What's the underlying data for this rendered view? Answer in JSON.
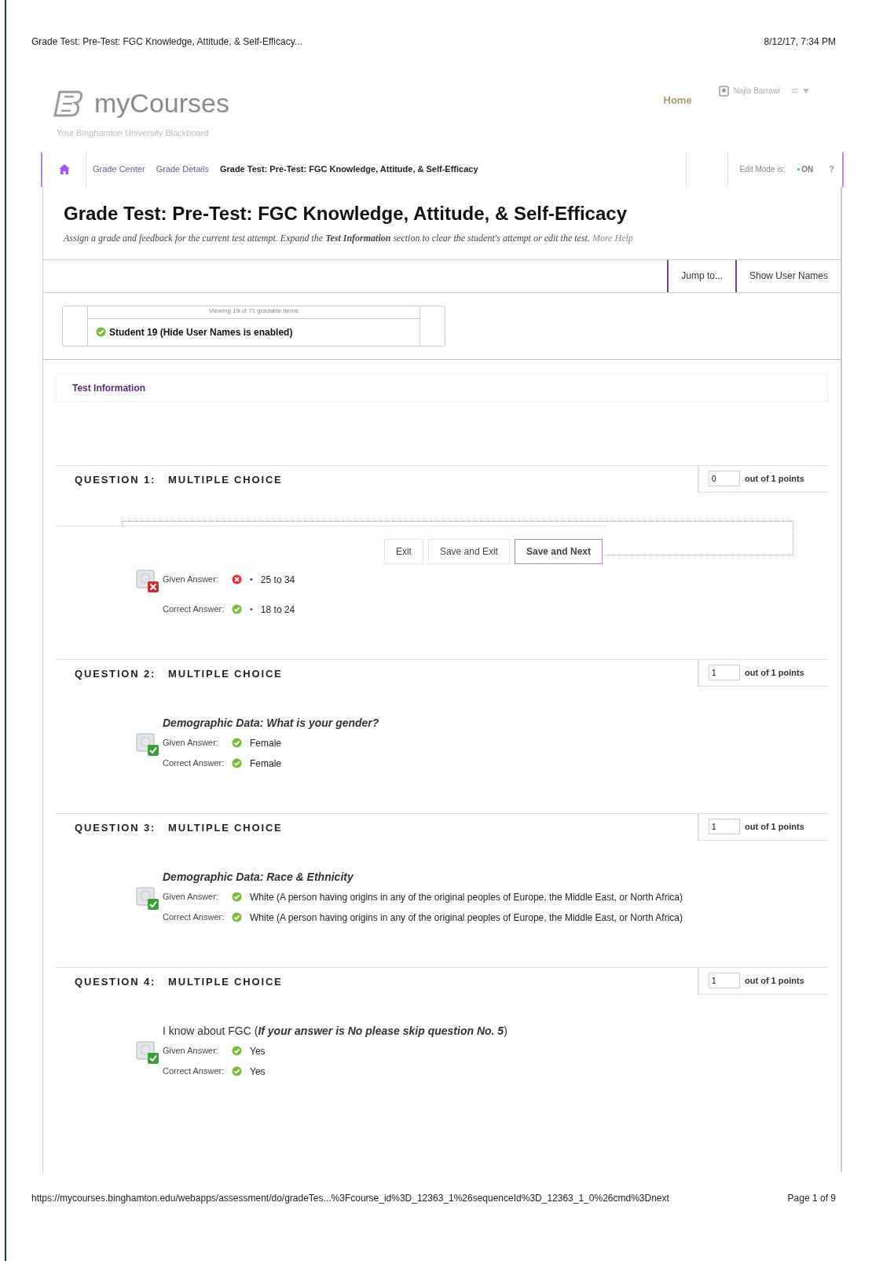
{
  "print_header": {
    "title": "Grade Test: Pre-Test: FGC Knowledge, Attitude, & Self-Efficacy...",
    "date": "8/12/17, 7:34 PM"
  },
  "brand": {
    "name": "myCourses",
    "tagline": "Your Binghamton University Blackboard"
  },
  "top_nav": {
    "home": "Home",
    "user": "Najla Barrawi",
    "count": "32"
  },
  "breadcrumbs": [
    {
      "label": "Grade Center",
      "current": false
    },
    {
      "label": "Grade Details",
      "current": false
    },
    {
      "label": "Grade Test: Pre-Test: FGC Knowledge, Attitude, & Self-Efficacy",
      "current": true
    }
  ],
  "edit_mode": {
    "label": "Edit Mode is:",
    "value": "ON",
    "on": true,
    "help": "?"
  },
  "page": {
    "title": "Grade Test: Pre-Test: FGC Knowledge, Attitude, & Self-Efficacy",
    "description": "Assign a grade and feedback for the current test attempt. Expand the **Test Information** section to clear the student's attempt or edit the test.",
    "help_link": "More Help"
  },
  "toolbar": [
    "Jump to...",
    "Show User Names"
  ],
  "student": {
    "viewing": "Viewing 19 of 71 gradable items",
    "name": "Student 19 (Hide User Names is enabled)"
  },
  "test_information": "Test Information",
  "questions": [
    {
      "number": "QUESTION 1:",
      "type": "MULTIPLE CHOICE",
      "score": "0",
      "out_of": "out of 1 points",
      "correct": false,
      "given_label": "Given Answer:",
      "given": "25 to 34",
      "correct_label": "Correct Answer:",
      "answer": "18 to 24",
      "marker": "•",
      "actions": [
        "Exit",
        "Save and Exit",
        "Save and Next"
      ]
    },
    {
      "number": "QUESTION 2:",
      "type": "MULTIPLE CHOICE",
      "score": "1",
      "out_of": "out of 1 points",
      "prompt": "**Demographic Data: What is your gender?**",
      "correct": true,
      "given_label": "Given Answer:",
      "given": "Female",
      "correct_label": "Correct Answer:",
      "answer": "Female"
    },
    {
      "number": "QUESTION 3:",
      "type": "MULTIPLE CHOICE",
      "score": "1",
      "out_of": "out of 1 points",
      "prompt": "**Demographic Data: Race & Ethnicity**",
      "correct": true,
      "given_label": "Given Answer:",
      "given": "White (A person having origins in any of the original peoples of Europe, the Middle East, or North Africa)",
      "correct_label": "Correct Answer:",
      "answer": "White (A person having origins in any of the original peoples of Europe, the Middle East, or North Africa)"
    },
    {
      "number": "QUESTION 4:",
      "type": "MULTIPLE CHOICE",
      "score": "1",
      "out_of": "out of 1 points",
      "prompt": "I know about FGC (**If your answer is No please skip question No. 5**)",
      "correct": true,
      "given_label": "Given Answer:",
      "given": "Yes",
      "correct_label": "Correct Answer:",
      "answer": "Yes"
    }
  ],
  "print_footer": {
    "url": "https://mycourses.binghamton.edu/webapps/assessment/do/gradeTes...%3Fcourse_id%3D_12363_1%26sequenceId%3D_12363_1_0%26cmd%3Dnext",
    "page": "Page 1 of 9"
  }
}
